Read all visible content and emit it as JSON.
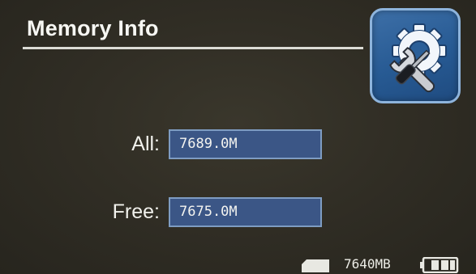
{
  "header": {
    "title": "Memory Info",
    "settings_icon": "settings-wrench-gear-icon"
  },
  "memory": {
    "all_label": "All:",
    "all_value": "7689.0M",
    "free_label": "Free:",
    "free_value": "7675.0M"
  },
  "status": {
    "storage_icon": "sd-card-icon",
    "storage_text": "7640MB",
    "battery_icon": "battery-icon"
  },
  "colors": {
    "background": "#312e25",
    "accent_blue": "#3b5686",
    "field_border": "#7e9cc2",
    "tile_blue": "#275a93"
  }
}
